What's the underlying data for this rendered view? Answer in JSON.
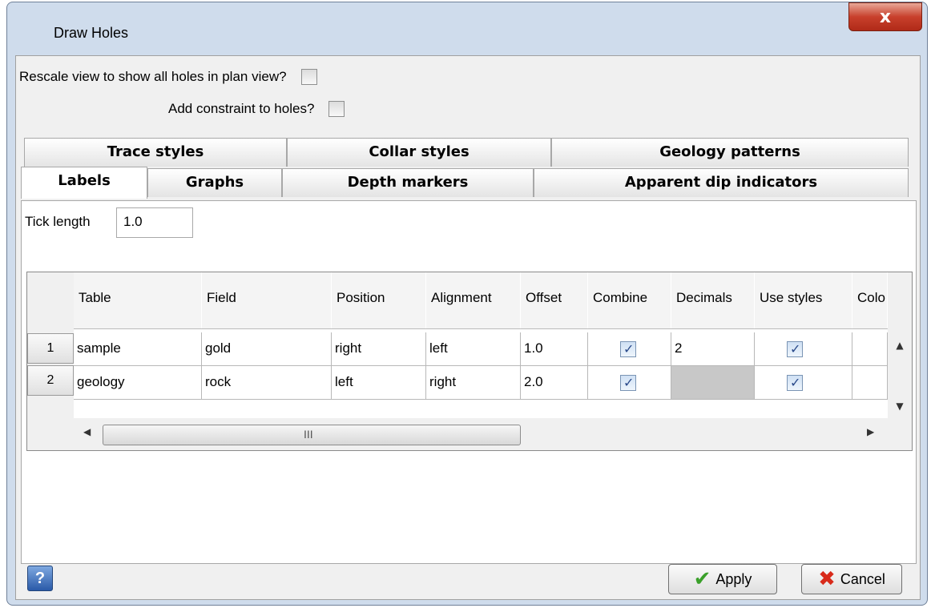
{
  "window": {
    "title": "Draw Holes",
    "close_glyph": "x"
  },
  "options": {
    "rescale_label": "Rescale view to show all holes in plan view?",
    "rescale_checked": false,
    "constraint_label": "Add constraint to holes?",
    "constraint_checked": false
  },
  "tabs": {
    "row1": [
      "Trace styles",
      "Collar styles",
      "Geology patterns"
    ],
    "row2": [
      "Labels",
      "Graphs",
      "Depth markers",
      "Apparent dip indicators"
    ],
    "selected": "Labels"
  },
  "tick": {
    "label": "Tick length",
    "value": "1.0"
  },
  "table": {
    "headers": [
      "Table",
      "Field",
      "Position",
      "Alignment",
      "Offset",
      "Combine",
      "Decimals",
      "Use styles",
      "Colo"
    ],
    "rows": [
      {
        "num": "1",
        "table": "sample",
        "field": "gold",
        "position": "right",
        "alignment": "left",
        "offset": "1.0",
        "combine": true,
        "decimals": "2",
        "use_styles": true
      },
      {
        "num": "2",
        "table": "geology",
        "field": "rock",
        "position": "left",
        "alignment": "right",
        "offset": "2.0",
        "combine": true,
        "decimals": "",
        "use_styles": true
      }
    ],
    "scroll_grip": "III"
  },
  "buttons": {
    "help": "?",
    "apply": "Apply",
    "cancel": "Cancel"
  },
  "icons": {
    "help": "help-icon",
    "apply": "checkmark-icon",
    "cancel": "red-x-icon",
    "close": "close-icon"
  }
}
